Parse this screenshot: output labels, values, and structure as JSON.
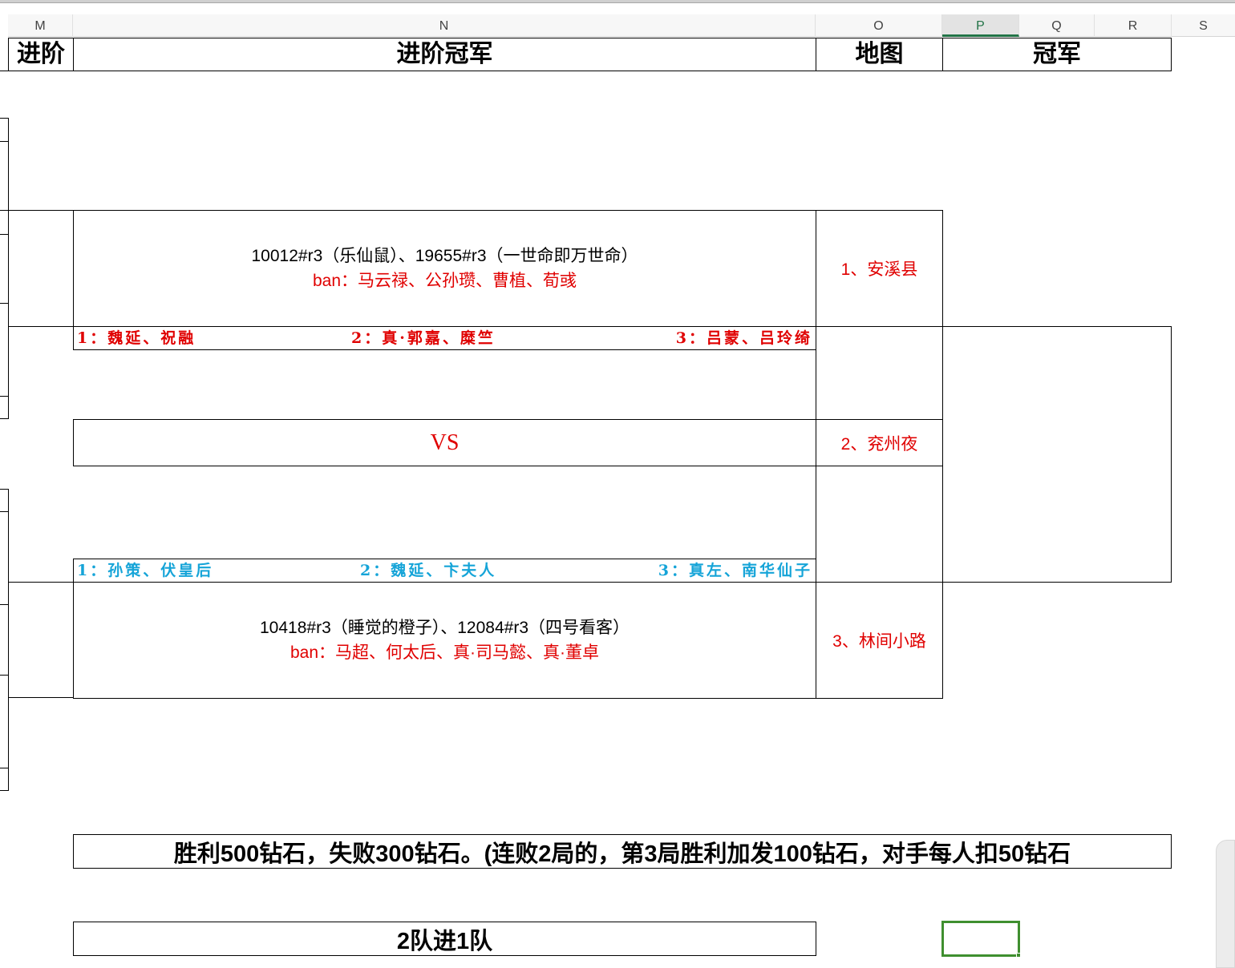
{
  "columns": [
    "M",
    "N",
    "O",
    "P",
    "Q",
    "R",
    "S"
  ],
  "selected_column": "P",
  "headers": {
    "advance": "进阶",
    "advance_champion": "进阶冠军",
    "map": "地图",
    "champion": "冠军"
  },
  "match1": {
    "players": "10012#r3（乐仙鼠）、19655#r3（一世命即万世命）",
    "ban": "ban：马云禄、公孙瓒、曹植、荀彧",
    "picks": [
      "1：魏延、祝融",
      "2：真·郭嘉、糜竺",
      "3：吕蒙、吕玲绮"
    ]
  },
  "vs_label": "VS",
  "match2": {
    "players": "10418#r3（睡觉的橙子）、12084#r3（四号看客）",
    "ban": "ban：马超、何太后、真·司马懿、真·董卓",
    "picks": [
      "1：孙策、伏皇后",
      "2：魏延、卞夫人",
      "3：真左、南华仙子"
    ]
  },
  "maps": [
    "1、安溪县",
    "2、兖州夜",
    "3、林间小路"
  ],
  "reward_text": "胜利500钻石，失败300钻石。(连败2局的，第3局胜利加发100钻石，对手每人扣50钻石",
  "advance_rule": "2队进1队",
  "colors": {
    "red": "#e00000",
    "blue": "#15a4d8",
    "selection": "#3f8f2f"
  }
}
